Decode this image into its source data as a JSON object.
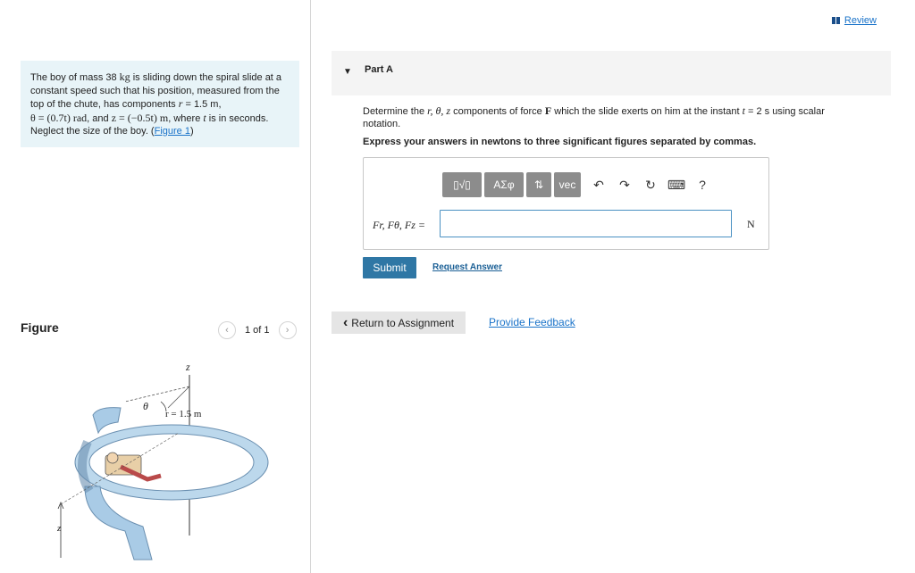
{
  "problem": {
    "text1": "The boy of mass 38",
    "mass_unit": "kg",
    "text2": " is sliding down the spiral slide at a constant speed such that his position, measured from the top of the chute, has components ",
    "r_sym": "r",
    "r_val": " = 1.5 m,",
    "theta_expr": "θ = (0.7t) rad",
    "text3": ", and ",
    "z_expr": "z = (−0.5t) m",
    "text4": ", where ",
    "t_sym": "t",
    "text5": " is in seconds. Neglect the size of the boy. (",
    "figure_link": "Figure 1",
    "text6": ")"
  },
  "figure": {
    "title": "Figure",
    "pager_label": "1 of 1",
    "prev_icon": "‹",
    "next_icon": "›",
    "label_z_top": "z",
    "label_theta": "θ",
    "label_r": "r = 1.5 m",
    "label_z_side": "z"
  },
  "review": {
    "label": "Review"
  },
  "part": {
    "caret": "▼",
    "title": "Part A"
  },
  "question": {
    "q1": "Determine the ",
    "vars": "r, θ, z",
    "q2": " components of force ",
    "force": "F",
    "q3": " which the slide exerts on him at the instant ",
    "t_expr": "t",
    "q4": " = 2 s using scalar notation."
  },
  "instructions": "Express your answers in newtons to three significant figures separated by commas.",
  "toolbar": {
    "templates": "▯√▯",
    "greek": "ΑΣφ",
    "arrows": "⇅",
    "vec": "vec",
    "undo": "↶",
    "redo": "↷",
    "reset": "↻",
    "keyboard": "⌨",
    "help": "?"
  },
  "answer": {
    "label": "Fr, Fθ, Fz =",
    "value": "",
    "unit": "N"
  },
  "buttons": {
    "submit": "Submit",
    "request": "Request Answer",
    "return": "Return to Assignment",
    "return_icon": "‹",
    "feedback": "Provide Feedback"
  }
}
